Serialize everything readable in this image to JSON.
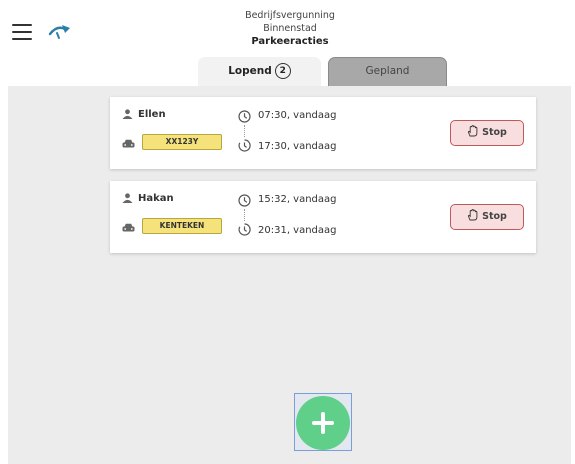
{
  "header": {
    "title_line1": "Bedrijfsvergunning",
    "title_line2": "Binnenstad",
    "subtitle": "Parkeeracties"
  },
  "tabs": [
    {
      "label": "Lopend",
      "count": "2"
    },
    {
      "label": "Gepland"
    }
  ],
  "sessions": [
    {
      "user": "Ellen",
      "plate": "XX123Y",
      "start_time": "07:30, vandaag",
      "end_time": "17:30, vandaag",
      "stop_label": "Stop"
    },
    {
      "user": "Hakan",
      "plate": "KENTEKEN",
      "start_time": "15:32, vandaag",
      "end_time": "20:31, vandaag",
      "stop_label": "Stop"
    }
  ],
  "colors": {
    "plate": "#f6e27a",
    "stop_button": "#f8dede",
    "fab": "#5fcf8a",
    "logo": "#2b7fa8"
  },
  "icons": {
    "menu": "hamburger-menu-icon",
    "logo": "app-logo-icon",
    "user": "person-icon",
    "car": "car-icon",
    "start": "clock-icon",
    "end": "timer-icon",
    "stop": "hand-icon",
    "add": "plus-icon"
  }
}
